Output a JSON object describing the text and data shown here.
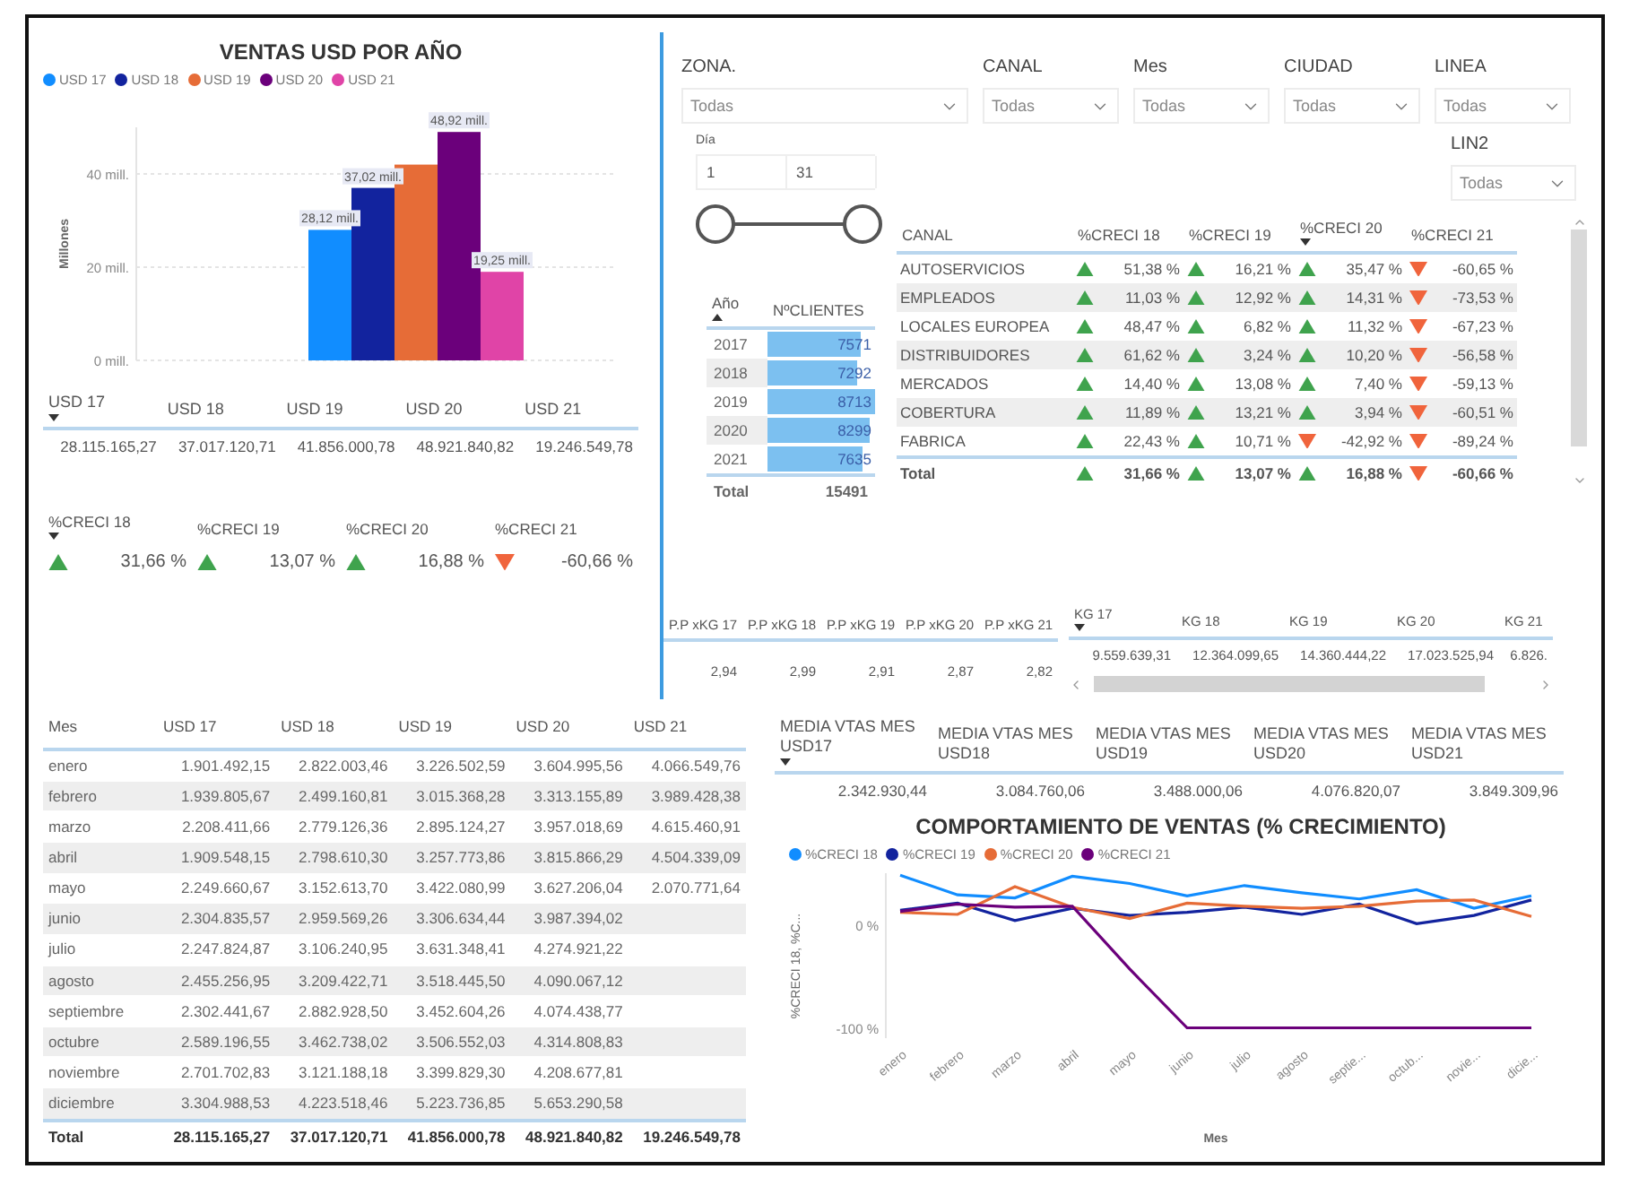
{
  "sales_chart": {
    "chart_data": {
      "type": "bar",
      "title": "VENTAS USD POR AÑO",
      "ylabel": "Millones",
      "ylim": [
        0,
        50
      ],
      "yticks": [
        {
          "value": 0,
          "label": "0 mill."
        },
        {
          "value": 20,
          "label": "20 mill."
        },
        {
          "value": 40,
          "label": "40 mill."
        }
      ],
      "series": [
        {
          "name": "USD 17",
          "color": "#118dff",
          "values": [
            28
          ]
        },
        {
          "name": "USD 18",
          "color": "#12239e",
          "values": [
            37
          ]
        },
        {
          "name": "USD 19",
          "color": "#e66c37",
          "values": [
            42
          ]
        },
        {
          "name": "USD 20",
          "color": "#6b007b",
          "values": [
            49
          ]
        },
        {
          "name": "USD 21",
          "color": "#e044a7",
          "values": [
            19
          ]
        }
      ],
      "value_labels": [
        "28,12 mill.",
        "37,02 mill.",
        null,
        "48,92 mill.",
        "19,25 mill."
      ]
    }
  },
  "usd_totals": {
    "columns": [
      {
        "label": "USD 17",
        "sorted_descending": true
      },
      {
        "label": "USD 18"
      },
      {
        "label": "USD 19"
      },
      {
        "label": "USD 20"
      },
      {
        "label": "USD 21"
      }
    ],
    "values": [
      "28.115.165,27",
      "37.017.120,71",
      "41.856.000,78",
      "48.921.840,82",
      "19.246.549,78"
    ]
  },
  "growth": {
    "columns": [
      {
        "label": "%CRECI 18",
        "sorted_descending": true
      },
      {
        "label": "%CRECI 19"
      },
      {
        "label": "%CRECI 20"
      },
      {
        "label": "%CRECI 21"
      }
    ],
    "values": [
      {
        "value": "31,66 %",
        "up": true
      },
      {
        "value": "13,07 %",
        "up": true
      },
      {
        "value": "16,88 %",
        "up": true
      },
      {
        "value": "-60,66 %",
        "up": false
      }
    ]
  },
  "filters": [
    {
      "label": "ZONA.",
      "value": "Todas"
    },
    {
      "label": "CANAL",
      "value": "Todas"
    },
    {
      "label": "Mes",
      "value": "Todas"
    },
    {
      "label": "CIUDAD",
      "value": "Todas"
    },
    {
      "label": "LINEA",
      "value": "Todas"
    }
  ],
  "lin2_filter": {
    "label": "LIN2",
    "value": "Todas"
  },
  "day_slider": {
    "label": "Día",
    "from": "1",
    "to": "31",
    "handles": [
      {
        "level": 0
      },
      {
        "level": 1
      }
    ]
  },
  "year_table": {
    "columns": [
      {
        "label": "Año",
        "sorted_ascending": true
      },
      {
        "label": "NºCLIENTES"
      }
    ],
    "rows": [
      {
        "year": "2017",
        "clients": "7571"
      },
      {
        "year": "2018",
        "clients": "7292"
      },
      {
        "year": "2019",
        "clients": "8713"
      },
      {
        "year": "2020",
        "clients": "8299"
      },
      {
        "year": "2021",
        "clients": "7635"
      }
    ],
    "total": {
      "label": "Total",
      "value": "15491"
    }
  },
  "canal_table": {
    "columns": [
      {
        "label": "CANAL"
      },
      {
        "label": "%CRECI 18"
      },
      {
        "label": "%CRECI 19"
      },
      {
        "label": "%CRECI 20",
        "sorted_descending": true
      },
      {
        "label": "%CRECI 21"
      }
    ],
    "rows": [
      {
        "canal": "AUTOSERVICIOS",
        "values": [
          {
            "value": "51,38 %",
            "up": true
          },
          {
            "value": "16,21 %",
            "up": true
          },
          {
            "value": "35,47 %",
            "up": true
          },
          {
            "value": "-60,65 %",
            "up": false
          }
        ]
      },
      {
        "canal": "EMPLEADOS",
        "values": [
          {
            "value": "11,03 %",
            "up": true
          },
          {
            "value": "12,92 %",
            "up": true
          },
          {
            "value": "14,31 %",
            "up": true
          },
          {
            "value": "-73,53 %",
            "up": false
          }
        ]
      },
      {
        "canal": "LOCALES EUROPEA",
        "values": [
          {
            "value": "48,47 %",
            "up": true
          },
          {
            "value": "6,82 %",
            "up": true
          },
          {
            "value": "11,32 %",
            "up": true
          },
          {
            "value": "-67,23 %",
            "up": false
          }
        ]
      },
      {
        "canal": "DISTRIBUIDORES",
        "values": [
          {
            "value": "61,62 %",
            "up": true
          },
          {
            "value": "3,24 %",
            "up": true
          },
          {
            "value": "10,20 %",
            "up": true
          },
          {
            "value": "-56,58 %",
            "up": false
          }
        ]
      },
      {
        "canal": "MERCADOS",
        "values": [
          {
            "value": "14,40 %",
            "up": true
          },
          {
            "value": "13,08 %",
            "up": true
          },
          {
            "value": "7,40 %",
            "up": true
          },
          {
            "value": "-59,13 %",
            "up": false
          }
        ]
      },
      {
        "canal": "COBERTURA",
        "values": [
          {
            "value": "11,89 %",
            "up": true
          },
          {
            "value": "13,21 %",
            "up": true
          },
          {
            "value": "3,94 %",
            "up": true
          },
          {
            "value": "-60,51 %",
            "up": false
          }
        ]
      },
      {
        "canal": "FABRICA",
        "values": [
          {
            "value": "22,43 %",
            "up": true
          },
          {
            "value": "10,71 %",
            "up": true
          },
          {
            "value": "-42,92 %",
            "up": false
          },
          {
            "value": "-89,24 %",
            "up": false
          }
        ]
      }
    ],
    "total": {
      "label": "Total",
      "values": [
        {
          "value": "31,66 %",
          "up": true
        },
        {
          "value": "13,07 %",
          "up": true
        },
        {
          "value": "16,88 %",
          "up": true
        },
        {
          "value": "-60,66 %",
          "up": false
        }
      ]
    }
  },
  "price_table": {
    "columns": [
      {
        "label": "P.P xKG 17"
      },
      {
        "label": "P.P xKG 18"
      },
      {
        "label": "P.P xKG 19"
      },
      {
        "label": "P.P xKG 20"
      },
      {
        "label": "P.P xKG 21"
      }
    ],
    "values": [
      "2,94",
      "2,99",
      "2,91",
      "2,87",
      "2,82"
    ]
  },
  "kg_table": {
    "columns": [
      {
        "label": "KG 17",
        "sorted_descending": true
      },
      {
        "label": "KG 18"
      },
      {
        "label": "KG 19"
      },
      {
        "label": "KG 20"
      },
      {
        "label": "KG 21"
      }
    ],
    "values": [
      "9.559.639,31",
      "12.364.099,65",
      "14.360.444,22",
      "17.023.525,94",
      "6.826."
    ]
  },
  "monthly_table": {
    "columns": [
      "Mes",
      "USD 17",
      "USD 18",
      "USD 19",
      "USD 20",
      "USD 21"
    ],
    "rows": [
      {
        "month": "enero",
        "values": [
          "1.901.492,15",
          "2.822.003,46",
          "3.226.502,59",
          "3.604.995,56",
          "4.066.549,76"
        ]
      },
      {
        "month": "febrero",
        "values": [
          "1.939.805,67",
          "2.499.160,81",
          "3.015.368,28",
          "3.313.155,89",
          "3.989.428,38"
        ]
      },
      {
        "month": "marzo",
        "values": [
          "2.208.411,66",
          "2.779.126,36",
          "2.895.124,27",
          "3.957.018,69",
          "4.615.460,91"
        ]
      },
      {
        "month": "abril",
        "values": [
          "1.909.548,15",
          "2.798.610,30",
          "3.257.773,86",
          "3.815.866,29",
          "4.504.339,09"
        ]
      },
      {
        "month": "mayo",
        "values": [
          "2.249.660,67",
          "3.152.613,70",
          "3.422.080,99",
          "3.627.206,04",
          "2.070.771,64"
        ]
      },
      {
        "month": "junio",
        "values": [
          "2.304.835,57",
          "2.959.569,26",
          "3.306.634,44",
          "3.987.394,02"
        ]
      },
      {
        "month": "julio",
        "values": [
          "2.247.824,87",
          "3.106.240,95",
          "3.631.348,41",
          "4.274.921,22"
        ]
      },
      {
        "month": "agosto",
        "values": [
          "2.455.256,95",
          "3.209.422,71",
          "3.518.445,50",
          "4.090.067,12"
        ]
      },
      {
        "month": "septiembre",
        "values": [
          "2.302.441,67",
          "2.882.928,50",
          "3.452.604,26",
          "4.074.438,77"
        ]
      },
      {
        "month": "octubre",
        "values": [
          "2.589.196,55",
          "3.462.738,02",
          "3.506.552,03",
          "4.314.808,83"
        ]
      },
      {
        "month": "noviembre",
        "values": [
          "2.701.702,83",
          "3.121.188,18",
          "3.399.829,30",
          "4.208.677,81"
        ]
      },
      {
        "month": "diciembre",
        "values": [
          "3.304.988,53",
          "4.223.518,46",
          "5.223.736,85",
          "5.653.290,58"
        ]
      }
    ],
    "total": {
      "label": "Total",
      "values": [
        "28.115.165,27",
        "37.017.120,71",
        "41.856.000,78",
        "48.921.840,82",
        "19.246.549,78"
      ]
    }
  },
  "monthly_average": {
    "columns": [
      {
        "label": "MEDIA VTAS MES USD17",
        "sorted_descending": true
      },
      {
        "label": "MEDIA VTAS MES USD18"
      },
      {
        "label": "MEDIA VTAS MES USD19"
      },
      {
        "label": "MEDIA VTAS MES USD20"
      },
      {
        "label": "MEDIA VTAS MES USD21"
      }
    ],
    "values": [
      "2.342.930,44",
      "3.084.760,06",
      "3.488.000,06",
      "4.076.820,07",
      "3.849.309,96"
    ]
  },
  "growth_chart": {
    "chart_data": {
      "type": "line",
      "title": "COMPORTAMIENTO DE VENTAS (% CRECIMIENTO)",
      "xlabel": "Mes",
      "ylabel": "%CRECI 18, %C...",
      "categories": [
        "enero",
        "febrero",
        "marzo",
        "abril",
        "mayo",
        "junio",
        "julio",
        "agosto",
        "septie...",
        "octub...",
        "novie...",
        "dicie..."
      ],
      "ylim": [
        -110,
        50
      ],
      "yticks": [
        {
          "value": 0,
          "label": "0 %"
        },
        {
          "value": -100,
          "label": "-100 %"
        }
      ],
      "series": [
        {
          "name": "%CRECI 18",
          "color": "#118dff",
          "values": [
            48,
            29,
            26,
            47,
            40,
            28,
            38,
            31,
            25,
            34,
            16,
            28
          ]
        },
        {
          "name": "%CRECI 19",
          "color": "#12239e",
          "values": [
            14,
            21,
            4,
            16,
            9,
            12,
            17,
            10,
            20,
            1,
            9,
            24
          ]
        },
        {
          "name": "%CRECI 20",
          "color": "#e66c37",
          "values": [
            12,
            10,
            37,
            17,
            6,
            21,
            18,
            16,
            18,
            23,
            24,
            8
          ]
        },
        {
          "name": "%CRECI 21",
          "color": "#6b007b",
          "values": [
            13,
            20,
            17,
            18,
            -43,
            -100,
            -100,
            -100,
            -100,
            -100,
            -100,
            -100
          ]
        }
      ]
    }
  }
}
